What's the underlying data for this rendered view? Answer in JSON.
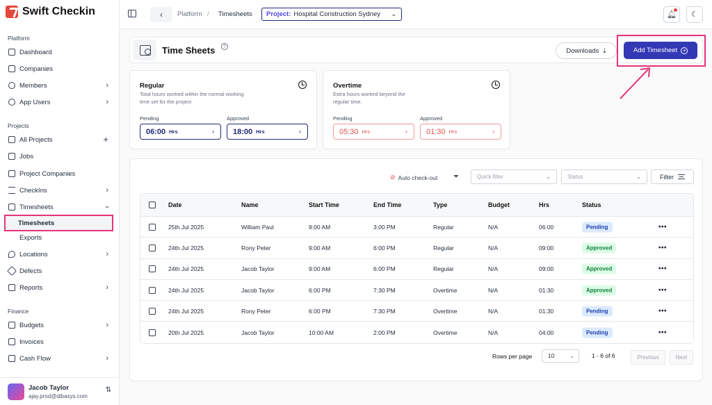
{
  "app": {
    "name": "Swift Checkin"
  },
  "sidebar": {
    "sections": [
      "Platform",
      "Projects",
      "Finance"
    ],
    "platform_items": [
      {
        "label": "Dashboard",
        "icon": "grid-icon"
      },
      {
        "label": "Companies",
        "icon": "building-icon"
      },
      {
        "label": "Members",
        "icon": "users-icon"
      },
      {
        "label": "App Users",
        "icon": "user-icon"
      }
    ],
    "project_items": [
      {
        "label": "All Projects",
        "icon": "folder-icon"
      },
      {
        "label": "Jobs",
        "icon": "clipboard-icon"
      },
      {
        "label": "Project Companies",
        "icon": "building-icon"
      },
      {
        "label": "CheckIns",
        "icon": "list-check-icon"
      },
      {
        "label": "Timesheets",
        "icon": "timesheet-icon"
      },
      {
        "label": "Timesheets",
        "icon": ""
      },
      {
        "label": "Exports",
        "icon": ""
      },
      {
        "label": "Locations",
        "icon": "map-pin-icon"
      },
      {
        "label": "Defects",
        "icon": "wrench-icon"
      },
      {
        "label": "Reports",
        "icon": "chart-icon"
      }
    ],
    "finance_items": [
      {
        "label": "Budgets",
        "icon": "wallet-icon"
      },
      {
        "label": "Invoices",
        "icon": "invoice-icon"
      },
      {
        "label": "Cash Flow",
        "icon": "cash-icon"
      }
    ],
    "user": {
      "name": "Jacob Taylor",
      "email": "ajay.prod@dibasys.com"
    }
  },
  "topbar": {
    "breadcrumb": [
      "Platform",
      "Timesheets"
    ],
    "breadcrumb_sep": "/",
    "project_label": "Project:",
    "project_value": "Hospital Construction Sydney"
  },
  "header": {
    "title": "Time Sheets",
    "help": "?",
    "downloads_label": "Downloads",
    "add_label": "Add Timesheet"
  },
  "stats": {
    "regular": {
      "title": "Regular",
      "desc": "Total hours worked within the normal working time set for the project",
      "pending_label": "Pending",
      "pending_value": "06:00",
      "approved_label": "Approved",
      "approved_value": "18:00",
      "unit": "Hrs"
    },
    "overtime": {
      "title": "Overtime",
      "desc": "Extra hours worked beyond the regular time.",
      "pending_label": "Pending",
      "pending_value": "05:30",
      "approved_label": "Approved",
      "approved_value": "01:30",
      "unit": "Hrs"
    }
  },
  "toolbar": {
    "auto_checkout": "Auto check-out",
    "quick_filter_placeholder": "Quick filter",
    "status_placeholder": "Status",
    "filter_label": "Filter"
  },
  "table": {
    "columns": [
      "Date",
      "Name",
      "Start Time",
      "End Time",
      "Type",
      "Budget",
      "Hrs",
      "Status"
    ],
    "rows": [
      {
        "date": "25th Jul 2025",
        "name": "William Paul",
        "start": "9:00 AM",
        "end": "3:00 PM",
        "type": "Regular",
        "budget": "N/A",
        "hrs": "06:00",
        "status": "Pending"
      },
      {
        "date": "24th Jul 2025",
        "name": "Rony Peter",
        "start": "9:00 AM",
        "end": "6:00 PM",
        "type": "Regular",
        "budget": "N/A",
        "hrs": "09:00",
        "status": "Approved"
      },
      {
        "date": "24th Jul 2025",
        "name": "Jacob Taylor",
        "start": "9:00 AM",
        "end": "6:00 PM",
        "type": "Regular",
        "budget": "N/A",
        "hrs": "09:00",
        "status": "Approved"
      },
      {
        "date": "24th Jul 2025",
        "name": "Jacob Taylor",
        "start": "6:00 PM",
        "end": "7:30 PM",
        "type": "Overtime",
        "budget": "N/A",
        "hrs": "01:30",
        "status": "Approved"
      },
      {
        "date": "24th Jul 2025",
        "name": "Rony Peter",
        "start": "6:00 PM",
        "end": "7:30 PM",
        "type": "Overtime",
        "budget": "N/A",
        "hrs": "01:30",
        "status": "Pending"
      },
      {
        "date": "20th Jul 2025",
        "name": "Jacob Taylor",
        "start": "10:00 AM",
        "end": "2:00 PM",
        "type": "Overtime",
        "budget": "N/A",
        "hrs": "04:00",
        "status": "Pending"
      }
    ],
    "row_action": "•••"
  },
  "pager": {
    "rows_label": "Rows per page",
    "rows_value": "10",
    "range": "1 - 6 of 6",
    "prev": "Previous",
    "next": "Next"
  },
  "colors": {
    "accent": "#3338b5",
    "highlight": "#e6337a",
    "brand": "#e2483c"
  }
}
